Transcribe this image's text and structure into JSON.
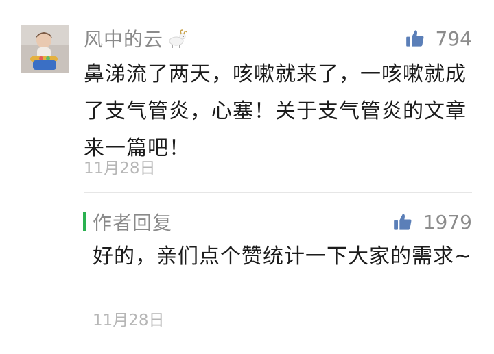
{
  "comment": {
    "username": "风中的云",
    "like_count": "794",
    "text": "鼻涕流了两天，咳嗽就来了，一咳嗽就成了支气管炎，心塞！关于支气管炎的文章来一篇吧！",
    "date": "11月28日"
  },
  "reply": {
    "author": "作者回复",
    "like_count": "1979",
    "text": "好的，亲们点个赞统计一下大家的需求~",
    "date": "11月28日"
  },
  "colors": {
    "like_icon": "#5b7fb8",
    "reply_bar": "#2ab150",
    "meta_text": "#8a8a8a",
    "body_text": "#1c1c1c",
    "date_text": "#b6b6b6"
  },
  "icons": {
    "like": "thumbs-up-icon",
    "username_decoration": "goat-icon"
  }
}
